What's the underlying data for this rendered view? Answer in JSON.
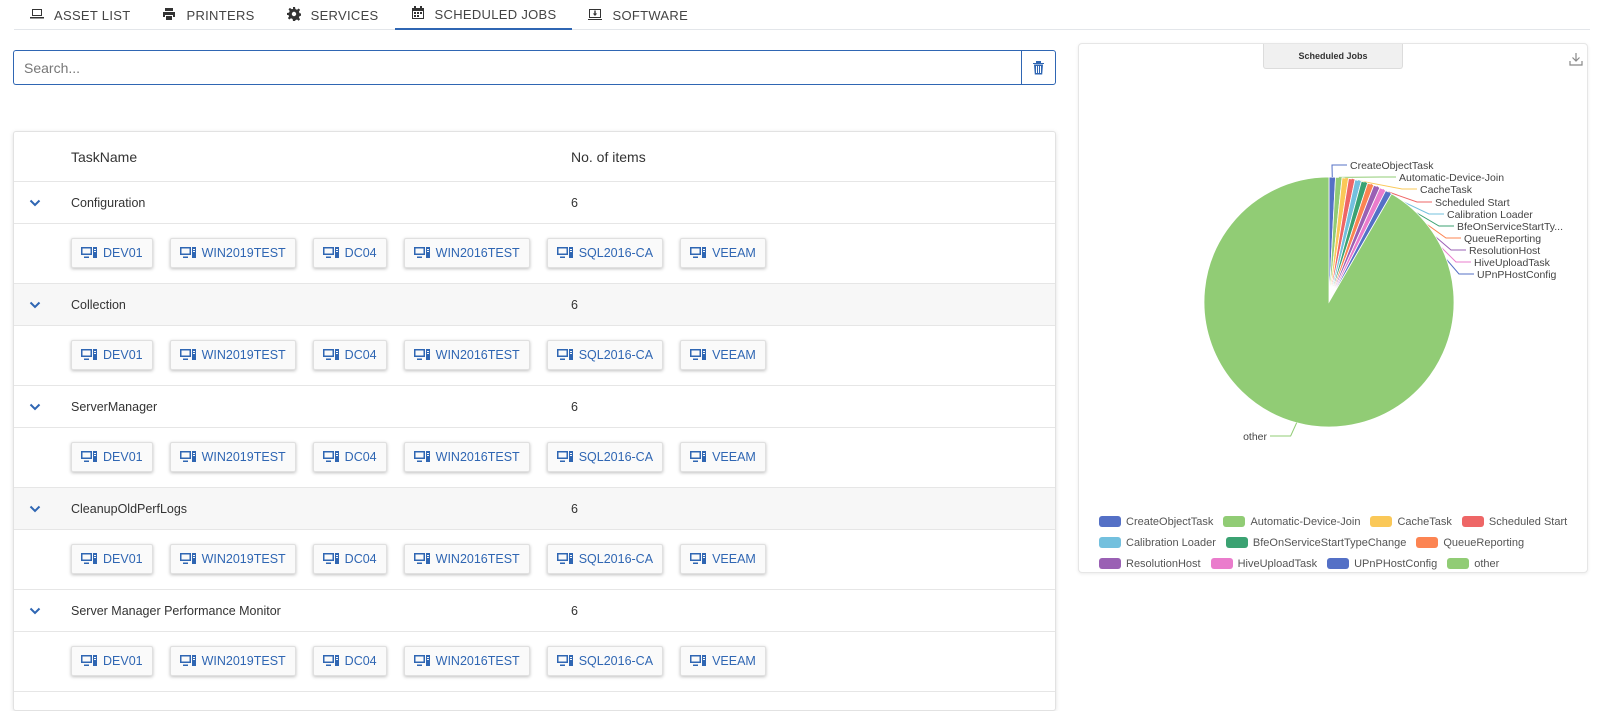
{
  "tabs": [
    {
      "label": "ASSET LIST",
      "icon": "laptop-icon"
    },
    {
      "label": "PRINTERS",
      "icon": "printer-icon"
    },
    {
      "label": "SERVICES",
      "icon": "gear-icon"
    },
    {
      "label": "SCHEDULED JOBS",
      "icon": "calendar-icon",
      "active": true
    },
    {
      "label": "SOFTWARE",
      "icon": "download-box-icon"
    }
  ],
  "search": {
    "placeholder": "Search...",
    "value": ""
  },
  "table": {
    "headers": {
      "name": "TaskName",
      "count": "No. of items"
    },
    "groups": [
      {
        "name": "Configuration",
        "count": "6",
        "hosts": [
          "DEV01",
          "WIN2019TEST",
          "DC04",
          "WIN2016TEST",
          "SQL2016-CA",
          "VEEAM"
        ]
      },
      {
        "name": "Collection",
        "count": "6",
        "hosts": [
          "DEV01",
          "WIN2019TEST",
          "DC04",
          "WIN2016TEST",
          "SQL2016-CA",
          "VEEAM"
        ]
      },
      {
        "name": "ServerManager",
        "count": "6",
        "hosts": [
          "DEV01",
          "WIN2019TEST",
          "DC04",
          "WIN2016TEST",
          "SQL2016-CA",
          "VEEAM"
        ]
      },
      {
        "name": "CleanupOldPerfLogs",
        "count": "6",
        "hosts": [
          "DEV01",
          "WIN2019TEST",
          "DC04",
          "WIN2016TEST",
          "SQL2016-CA",
          "VEEAM"
        ]
      },
      {
        "name": "Server Manager Performance Monitor",
        "count": "6",
        "hosts": [
          "DEV01",
          "WIN2019TEST",
          "DC04",
          "WIN2016TEST",
          "SQL2016-CA",
          "VEEAM"
        ]
      }
    ]
  },
  "colors": {
    "accent": "#2f66b3"
  },
  "chart_data": {
    "type": "pie",
    "title": "Scheduled Jobs",
    "legend_position": "bottom",
    "slices": [
      {
        "label": "CreateObjectTask",
        "value": 6,
        "color": "#5470c6"
      },
      {
        "label": "Automatic-Device-Join",
        "value": 6,
        "color": "#91cc75"
      },
      {
        "label": "CacheTask",
        "value": 6,
        "color": "#fac858"
      },
      {
        "label": "Scheduled Start",
        "value": 6,
        "color": "#ee6666"
      },
      {
        "label": "Calibration Loader",
        "value": 6,
        "color": "#73c0de"
      },
      {
        "label": "BfeOnServiceStartTypeChange",
        "label_short": "BfeOnServiceStartTy...",
        "value": 6,
        "color": "#3ba272"
      },
      {
        "label": "QueueReporting",
        "value": 6,
        "color": "#fc8452"
      },
      {
        "label": "ResolutionHost",
        "value": 6,
        "color": "#9a60b4"
      },
      {
        "label": "HiveUploadTask",
        "value": 6,
        "color": "#ea7ccc"
      },
      {
        "label": "UPnPHostConfig",
        "value": 6,
        "color": "#5470c6"
      },
      {
        "label": "other",
        "value": 660,
        "color": "#91cc75"
      }
    ]
  }
}
